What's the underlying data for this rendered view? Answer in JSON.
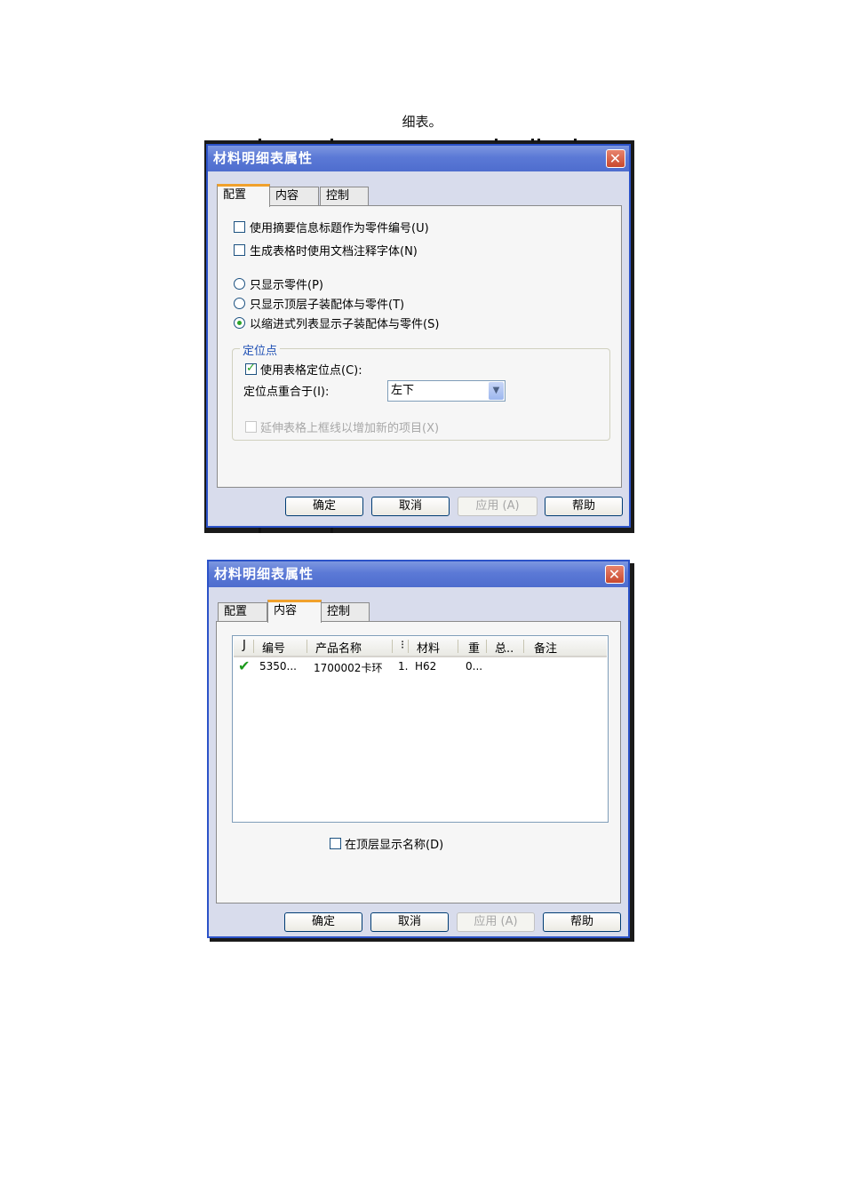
{
  "caption": "细表。",
  "dialog1": {
    "title": "材料明细表属性",
    "tabs": [
      "配置",
      "内容",
      "控制"
    ],
    "options": {
      "use_summary": "使用摘要信息标题作为零件编号(U)",
      "use_doc_font": "生成表格时使用文档注释字体(N)",
      "only_parts": "只显示零件(P)",
      "top_level": "只显示顶层子装配体与零件(T)",
      "indented": "以缩进式列表显示子装配体与零件(S)"
    },
    "anchor_group": {
      "title": "定位点",
      "use_anchor": "使用表格定位点(C):",
      "coincide_label": "定位点重合于(I):",
      "coincide_value": "左下",
      "extend": "延伸表格上框线以增加新的项目(X)"
    }
  },
  "dialog2": {
    "title": "材料明细表属性",
    "tabs": [
      "配置",
      "内容",
      "控制"
    ],
    "columns": [
      "J",
      "编号",
      "产品名称",
      "⁝",
      "材料",
      "重",
      "总..",
      "备注"
    ],
    "rows": [
      {
        "number": "5350...",
        "product": "1700002卡环",
        "qty": "1.",
        "material": "H62",
        "weight": "0..."
      }
    ],
    "show_top_name": "在顶层显示名称(D)"
  },
  "buttons": {
    "ok": "确定",
    "cancel": "取消",
    "apply": "应用 (A)",
    "help": "帮助"
  },
  "icons": {
    "close": "close-icon",
    "dropdown": "chevron-down-icon",
    "included": "checkmark-icon"
  },
  "colors": {
    "titlebar": "#5b79d6",
    "close": "#c8482e",
    "active_tab_accent": "#f0a12c",
    "group_title": "#1e4fb4"
  }
}
